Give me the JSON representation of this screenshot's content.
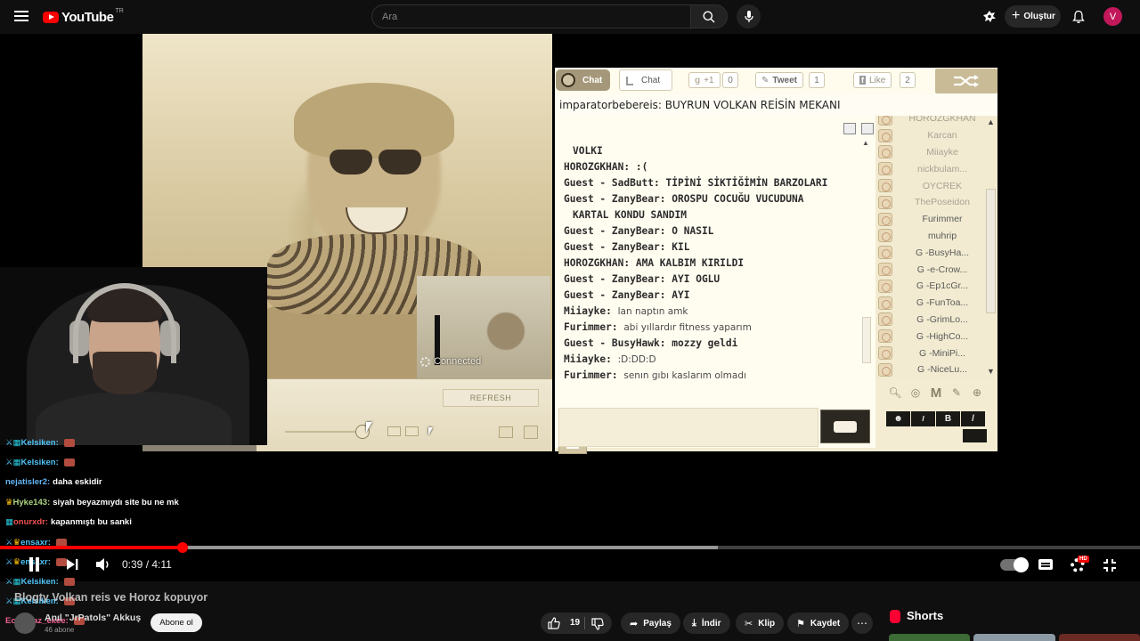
{
  "youtube": {
    "logo_text": "YouTube",
    "region": "TR",
    "search_placeholder": "Ara",
    "create_label": "Oluştur",
    "avatar_letter": "V"
  },
  "room": {
    "topic": "imparatorbebereis: BUYRUN VOLKAN REİSİN MEKANI",
    "tabs": {
      "chat_primary": "Chat",
      "chat_secondary": "Chat"
    },
    "social": {
      "gplus": "+1",
      "gplus_count": "0",
      "tweet": "Tweet",
      "tweet_count": "1",
      "like": "Like",
      "like_count": "2"
    },
    "webcam": {
      "status": "Connected",
      "partial_label": "ed",
      "refresh": "REFRESH"
    },
    "messages": [
      {
        "user": "",
        "text": "VOLKI",
        "style": "bold"
      },
      {
        "user": "HOROZGKHAN:",
        "text": ":(",
        "style": "bold"
      },
      {
        "user": "Guest - SadButt:",
        "text": "TİPİNİ SİKTİĞİMİN BARZOLARI",
        "style": "bold"
      },
      {
        "user": "Guest - ZanyBear:",
        "text": "OROSPU COCUĞU VUCUDUNA",
        "style": "bold"
      },
      {
        "user": "",
        "text": "KARTAL KONDU SANDIM",
        "style": "bold"
      },
      {
        "user": "Guest - ZanyBear:",
        "text": "O NASIL",
        "style": "bold"
      },
      {
        "user": "Guest - ZanyBear:",
        "text": "KIL",
        "style": "bold"
      },
      {
        "user": "HOROZGKHAN:",
        "text": "AMA KALBIM KIRILDI",
        "style": "bold"
      },
      {
        "user": "Guest - ZanyBear:",
        "text": "AYI OGLU",
        "style": "bold"
      },
      {
        "user": "Guest - ZanyBear:",
        "text": "AYI",
        "style": "bold"
      },
      {
        "user": "Miiayke:",
        "text": "lan naptın amk",
        "style": "light"
      },
      {
        "user": "Furimmer:",
        "text": "abi yıllardır fitness yaparım",
        "style": "light"
      },
      {
        "user": "Guest - BusyHawk:",
        "text": "mozzy geldi",
        "style": "bold"
      },
      {
        "user": "Miiayke:",
        "text": ":D:DD:D",
        "style": "light"
      },
      {
        "user": "Furimmer:",
        "text": "senın gıbı kaslarım olmadı",
        "style": "light"
      }
    ],
    "users": [
      {
        "name": "HOROZGKHAN",
        "faded": true
      },
      {
        "name": "Karcan",
        "faded": true
      },
      {
        "name": "Miiayke",
        "faded": true
      },
      {
        "name": "nickbulam...",
        "faded": true
      },
      {
        "name": "OYCREK",
        "faded": true
      },
      {
        "name": "ThePoseidon",
        "faded": true
      },
      {
        "name": "Furimmer",
        "faded": false
      },
      {
        "name": "muhrip",
        "faded": false
      },
      {
        "name": "G -BusyHa...",
        "faded": false
      },
      {
        "name": "G -e-Crow...",
        "faded": false
      },
      {
        "name": "G -Ep1cGr...",
        "faded": false
      },
      {
        "name": "G -FunToa...",
        "faded": false
      },
      {
        "name": "G -GrimLo...",
        "faded": false
      },
      {
        "name": "G -HighCo...",
        "faded": false
      },
      {
        "name": "G -MiniPi...",
        "faded": false
      },
      {
        "name": "G -NiceLu...",
        "faded": false
      }
    ],
    "format_tools": {
      "bold": "B",
      "italic": "I"
    }
  },
  "overlay_chat": [
    {
      "badge": "sword-mod",
      "nick": "Kelsiken:",
      "nick_color": "#4fc3f7",
      "text": "",
      "emote": true
    },
    {
      "badge": "sword-mod",
      "nick": "Kelsiken:",
      "nick_color": "#4fc3f7",
      "text": "",
      "emote": true
    },
    {
      "badge": "",
      "nick": "nejatisler2:",
      "nick_color": "#64b5f6",
      "text": "daha eskidir",
      "emote": false
    },
    {
      "badge": "crown",
      "nick": "Hyke143:",
      "nick_color": "#aed581",
      "text": "siyah beyazmıydı site bu ne mk",
      "emote": false
    },
    {
      "badge": "sub",
      "nick": "onurxdr:",
      "nick_color": "#ef5350",
      "text": "kapanmıştı bu sanki",
      "emote": false
    },
    {
      "badge": "sword-crown",
      "nick": "ensaxr:",
      "nick_color": "#4fc3f7",
      "text": "",
      "emote": true
    },
    {
      "badge": "sword-crown",
      "nick": "ensaxr:",
      "nick_color": "#4fc3f7",
      "text": "",
      "emote": true
    },
    {
      "badge": "sword-mod",
      "nick": "Kelsiken:",
      "nick_color": "#4fc3f7",
      "text": "",
      "emote": true
    },
    {
      "badge": "sword-mod",
      "nick": "Kelsiken:",
      "nick_color": "#4fc3f7",
      "text": "",
      "emote": true
    },
    {
      "badge": "",
      "nick": "Ecemnaz_ekee:",
      "nick_color": "#f06292",
      "text": "",
      "emote": true
    }
  ],
  "player": {
    "time": "0:39 / 4:11",
    "progress_played_pct": 16,
    "progress_buffered_pct": 63,
    "hd_badge": "HD"
  },
  "video": {
    "title": "Blogty Volkan reis ve Horoz kopuyor",
    "channel": "Anıl \"JrPatols\" Akkuş",
    "subs": "46 abone",
    "subscribe": "Abone ol",
    "likes": "19",
    "share": "Paylaş",
    "download": "İndir",
    "clip": "Klip",
    "save": "Kaydet",
    "shorts": "Shorts"
  },
  "colors": {
    "brand_red": "#ff0000",
    "room_bg": "#f3ecd3",
    "room_accent": "#a5987a"
  }
}
